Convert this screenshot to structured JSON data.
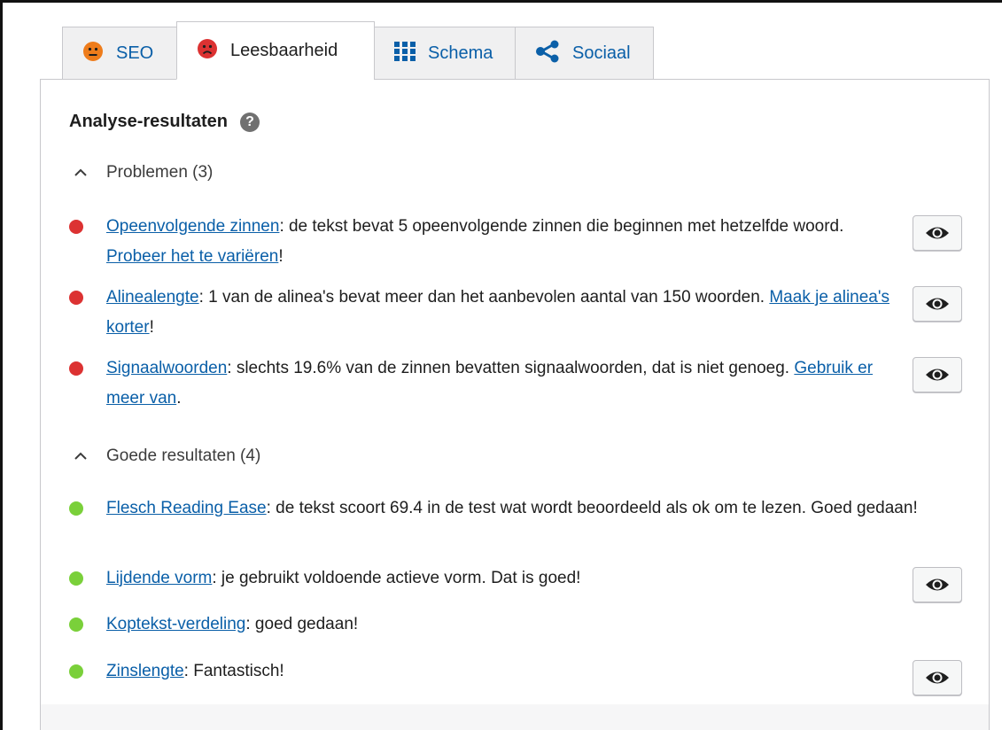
{
  "tabs": [
    {
      "label": "SEO",
      "icon": "neutral-face-icon",
      "color": "#ee7c1b",
      "active": false
    },
    {
      "label": "Leesbaarheid",
      "icon": "sad-face-icon",
      "color": "#dc3232",
      "active": true
    },
    {
      "label": "Schema",
      "icon": "grid-icon",
      "color": "#0a5fa8",
      "active": false
    },
    {
      "label": "Sociaal",
      "icon": "share-icon",
      "color": "#0a5fa8",
      "active": false
    }
  ],
  "panel": {
    "heading": "Analyse-resultaten",
    "help_icon": "?"
  },
  "problems": {
    "label": "Problemen (3)",
    "items": [
      {
        "status": "red",
        "link": "Opeenvolgende zinnen",
        "text1": ": de tekst bevat 5 opeenvolgende zinnen die beginnen met hetzelfde woord. ",
        "link2": "Probeer het te variëren",
        "text2": "!",
        "has_eye": true
      },
      {
        "status": "red",
        "link": "Alinealengte",
        "text1": ": 1 van de alinea's bevat meer dan het aanbevolen aantal van 150 woorden. ",
        "link2": "Maak je alinea's korter",
        "text2": "!",
        "has_eye": true
      },
      {
        "status": "red",
        "link": "Signaalwoorden",
        "text1": ": slechts 19.6% van de zinnen bevatten signaalwoorden, dat is niet genoeg. ",
        "link2": "Gebruik er meer van",
        "text2": ".",
        "has_eye": true
      }
    ]
  },
  "good": {
    "label": "Goede resultaten (4)",
    "items": [
      {
        "status": "green",
        "link": "Flesch Reading Ease",
        "text1": ": de tekst scoort 69.4 in de test wat wordt beoordeeld als ok om te lezen. Goed gedaan!",
        "has_eye": false
      },
      {
        "status": "green",
        "link": "Lijdende vorm",
        "text1": ": je gebruikt voldoende actieve vorm. Dat is goed!",
        "has_eye": true
      },
      {
        "status": "green",
        "link": "Koptekst-verdeling",
        "text1": ": goed gedaan!",
        "has_eye": false
      },
      {
        "status": "green",
        "link": "Zinslengte",
        "text1": ": Fantastisch!",
        "has_eye": true
      }
    ]
  },
  "colors": {
    "link": "#0a5fa8",
    "problem": "#dc3232",
    "good": "#7ad03a",
    "neutral": "#ee7c1b"
  }
}
